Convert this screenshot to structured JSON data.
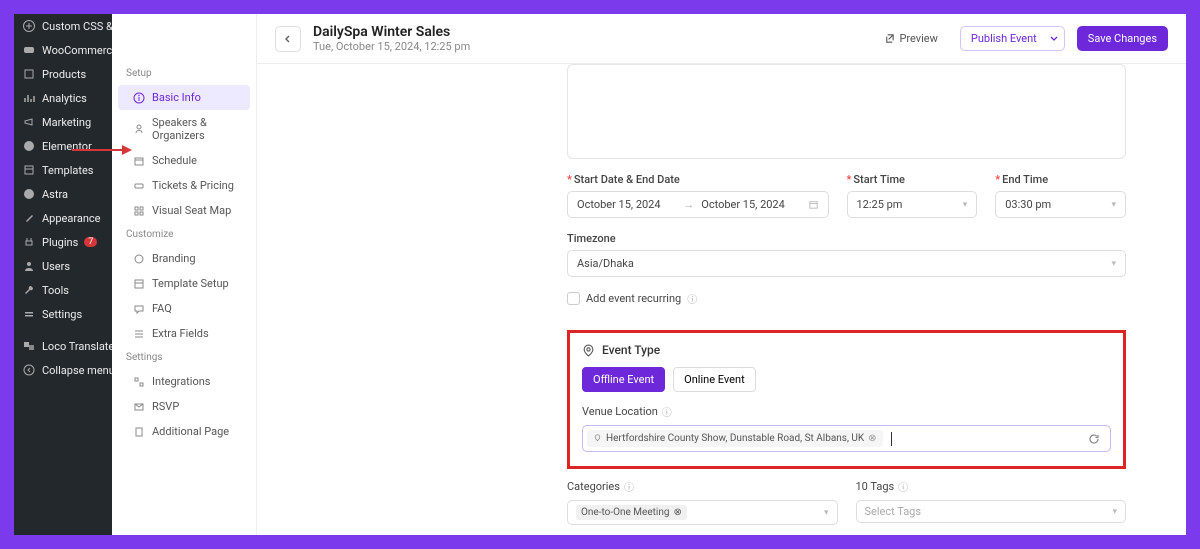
{
  "wp_sidebar": {
    "items": [
      {
        "label": "Custom CSS & JS",
        "icon": "plus"
      },
      {
        "label": "WooCommerce",
        "icon": "woo"
      },
      {
        "label": "Products",
        "icon": "box"
      },
      {
        "label": "Analytics",
        "icon": "chart"
      },
      {
        "label": "Marketing",
        "icon": "megaphone"
      },
      {
        "label": "Elementor",
        "icon": "elementor"
      },
      {
        "label": "Templates",
        "icon": "templates"
      },
      {
        "label": "Astra",
        "icon": "astra"
      },
      {
        "label": "Appearance",
        "icon": "brush"
      },
      {
        "label": "Plugins",
        "icon": "plug",
        "badge": "7"
      },
      {
        "label": "Users",
        "icon": "user"
      },
      {
        "label": "Tools",
        "icon": "wrench"
      },
      {
        "label": "Settings",
        "icon": "gear"
      },
      {
        "label": "Loco Translate",
        "icon": "translate"
      },
      {
        "label": "Collapse menu",
        "icon": "collapse"
      }
    ]
  },
  "sub_sidebar": {
    "groups": [
      {
        "title": "Setup",
        "items": [
          {
            "label": "Basic Info",
            "active": true
          },
          {
            "label": "Speakers & Organizers"
          },
          {
            "label": "Schedule"
          },
          {
            "label": "Tickets & Pricing"
          },
          {
            "label": "Visual Seat Map"
          }
        ]
      },
      {
        "title": "Customize",
        "items": [
          {
            "label": "Branding"
          },
          {
            "label": "Template Setup"
          },
          {
            "label": "FAQ"
          },
          {
            "label": "Extra Fields"
          }
        ]
      },
      {
        "title": "Settings",
        "items": [
          {
            "label": "Integrations"
          },
          {
            "label": "RSVP"
          },
          {
            "label": "Additional Page"
          }
        ]
      }
    ]
  },
  "header": {
    "title": "DailySpa Winter Sales",
    "subtitle": "Tue, October 15, 2024, 12:25 pm",
    "preview": "Preview",
    "publish": "Publish Event",
    "save": "Save Changes"
  },
  "form": {
    "date_label": "Start Date & End Date",
    "start_date": "October 15, 2024",
    "end_date": "October 15, 2024",
    "start_time_label": "Start Time",
    "start_time": "12:25 pm",
    "end_time_label": "End Time",
    "end_time": "03:30 pm",
    "timezone_label": "Timezone",
    "timezone": "Asia/Dhaka",
    "recurring": "Add event recurring",
    "event_type": "Event Type",
    "tab_offline": "Offline Event",
    "tab_online": "Online Event",
    "venue_label": "Venue Location",
    "venue_chip": "Hertfordshire County Show, Dunstable Road, St Albans, UK",
    "categories_label": "Categories",
    "categories_chip": "One-to-One Meeting",
    "tags_label": "10 Tags",
    "tags_placeholder": "Select Tags"
  }
}
